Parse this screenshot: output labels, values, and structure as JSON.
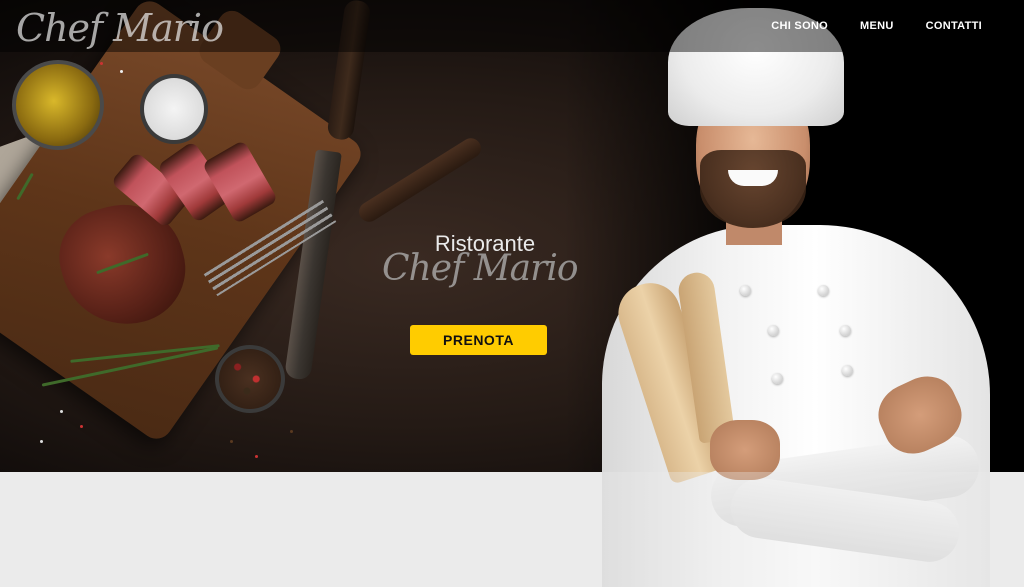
{
  "brand": {
    "logo_text": "Chef Mario"
  },
  "nav": {
    "items": [
      {
        "label": "CHI SONO"
      },
      {
        "label": "MENU"
      },
      {
        "label": "CONTATTI"
      }
    ]
  },
  "hero": {
    "subtitle": "Ristorante",
    "title": "Chef Mario",
    "cta_label": "PRENOTA"
  },
  "colors": {
    "accent": "#ffcc00",
    "header_bg": "#000000",
    "lower_bg": "#ebebeb"
  }
}
